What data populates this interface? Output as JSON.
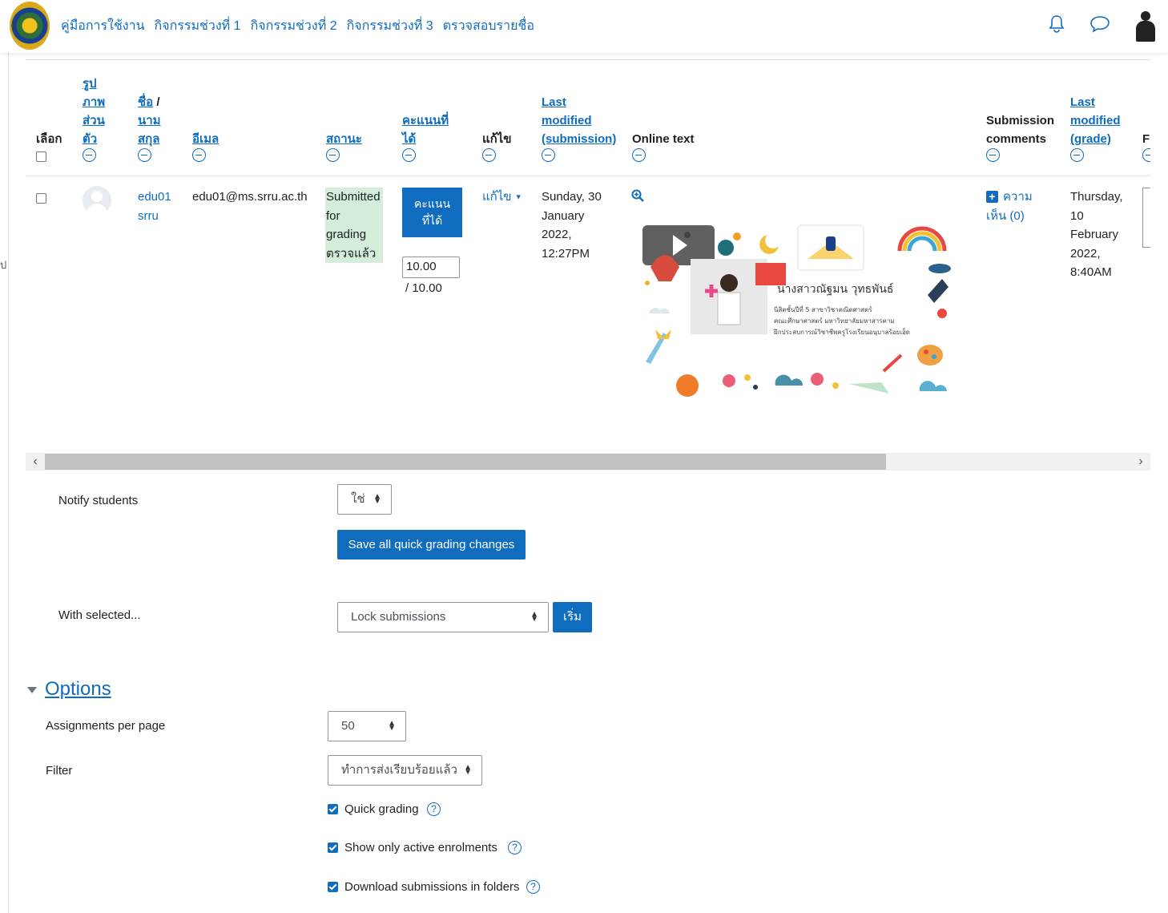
{
  "nav": {
    "items": [
      "คู่มือการใช้งาน",
      "กิจกรรมช่วงที่ 1",
      "กิจกรรมช่วงที่ 2",
      "กิจกรรมช่วงที่ 3",
      "ตรวจสอบรายชื่อ"
    ]
  },
  "sidebar_edge_text": "ป",
  "table": {
    "headers": {
      "select": "เลือก",
      "picture": [
        "รูป",
        "ภาพ",
        "ส่วน",
        "ตัว"
      ],
      "name": [
        "ชื่อ",
        "/",
        "นาม",
        "สกุล"
      ],
      "email": "อีเมล",
      "status": "สถานะ",
      "grade": [
        "คะแนนที่",
        "ได้"
      ],
      "edit": "แก้ไข",
      "last_modified_submission": [
        "Last",
        "modified",
        "(submission)"
      ],
      "online_text": "Online text",
      "submission_comments": [
        "Submission",
        "comments"
      ],
      "last_modified_grade": [
        "Last",
        "modified",
        "(grade)"
      ],
      "final_partial": "F"
    },
    "row": {
      "name": [
        "edu01",
        "srru"
      ],
      "email": "edu01@ms.srru.ac.th",
      "status": [
        "Submitted",
        "for",
        "grading",
        "ตรวจแล้ว"
      ],
      "grade_button": [
        "คะแนน",
        "ที่ได้"
      ],
      "grade_value": "10.00",
      "grade_max": "/ 10.00",
      "edit_label": "แก้ไข",
      "last_modified_submission": [
        "Sunday, 30",
        "January",
        "2022,",
        "12:27PM"
      ],
      "video_caption": "นางสาวณัฐมน วุทธพันธ์",
      "video_subtitle": [
        "นิสิตชั้นปีที่ 5 สาขาวิชาคณิตศาสตร์",
        "คณะศึกษาศาสตร์ มหาวิทยาลัยมหาสารคาม",
        "ฝึกประสบการณ์วิชาชีพครูโรงเรียนอนุบาลร้อยเอ็ด"
      ],
      "comments": [
        "ความ",
        "เห็น (0)"
      ],
      "last_modified_grade": [
        "Thursday,",
        "10",
        "February",
        "2022,",
        "8:40AM"
      ]
    }
  },
  "form": {
    "notify_label": "Notify students",
    "notify_value": "ใช่",
    "save_button": "Save all quick grading changes",
    "with_selected_label": "With selected...",
    "with_selected_value": "Lock submissions",
    "go_button": "เริ่ม"
  },
  "options": {
    "heading": "Options",
    "per_page_label": "Assignments per page",
    "per_page_value": "50",
    "filter_label": "Filter",
    "filter_value": "ทำการส่งเรียบร้อยแล้ว",
    "checks": [
      {
        "label": "Quick grading",
        "checked": true
      },
      {
        "label": "Show only active enrolments",
        "checked": true
      },
      {
        "label": "Download submissions in folders",
        "checked": true
      }
    ]
  },
  "colors": {
    "accent": "#0f6cbf",
    "status_bg": "#d4edda"
  }
}
